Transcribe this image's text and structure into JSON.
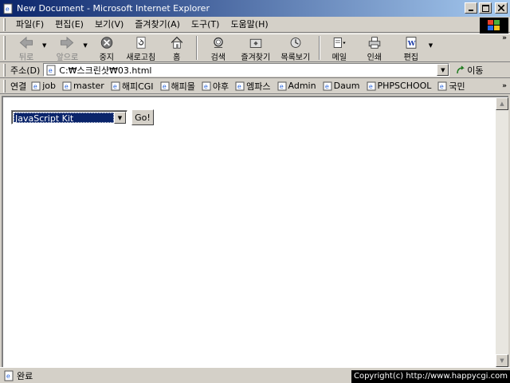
{
  "window": {
    "title": "New Document - Microsoft Internet Explorer"
  },
  "menu": {
    "items": [
      "파일(F)",
      "편집(E)",
      "보기(V)",
      "즐겨찾기(A)",
      "도구(T)",
      "도움말(H)"
    ]
  },
  "toolbar": {
    "back": "뒤로",
    "forward": "앞으로",
    "stop": "중지",
    "refresh": "새로고침",
    "home": "홈",
    "search": "검색",
    "favorites": "즐겨찾기",
    "history": "목록보기",
    "mail": "메일",
    "print": "인쇄",
    "edit": "편집"
  },
  "address": {
    "label": "주소(D)",
    "value": "C:₩스크린샷₩03.html",
    "go": "이동"
  },
  "links": {
    "label": "연결",
    "items": [
      "job",
      "master",
      "해피CGI",
      "해피몰",
      "야후",
      "엠파스",
      "Admin",
      "Daum",
      "PHPSCHOOL",
      "국민"
    ]
  },
  "page": {
    "select_value": "JavaScript Kit",
    "go_button": "Go!"
  },
  "status": {
    "text": "완료",
    "copyright": "Copyright(c) http://www.happycgi.com"
  }
}
